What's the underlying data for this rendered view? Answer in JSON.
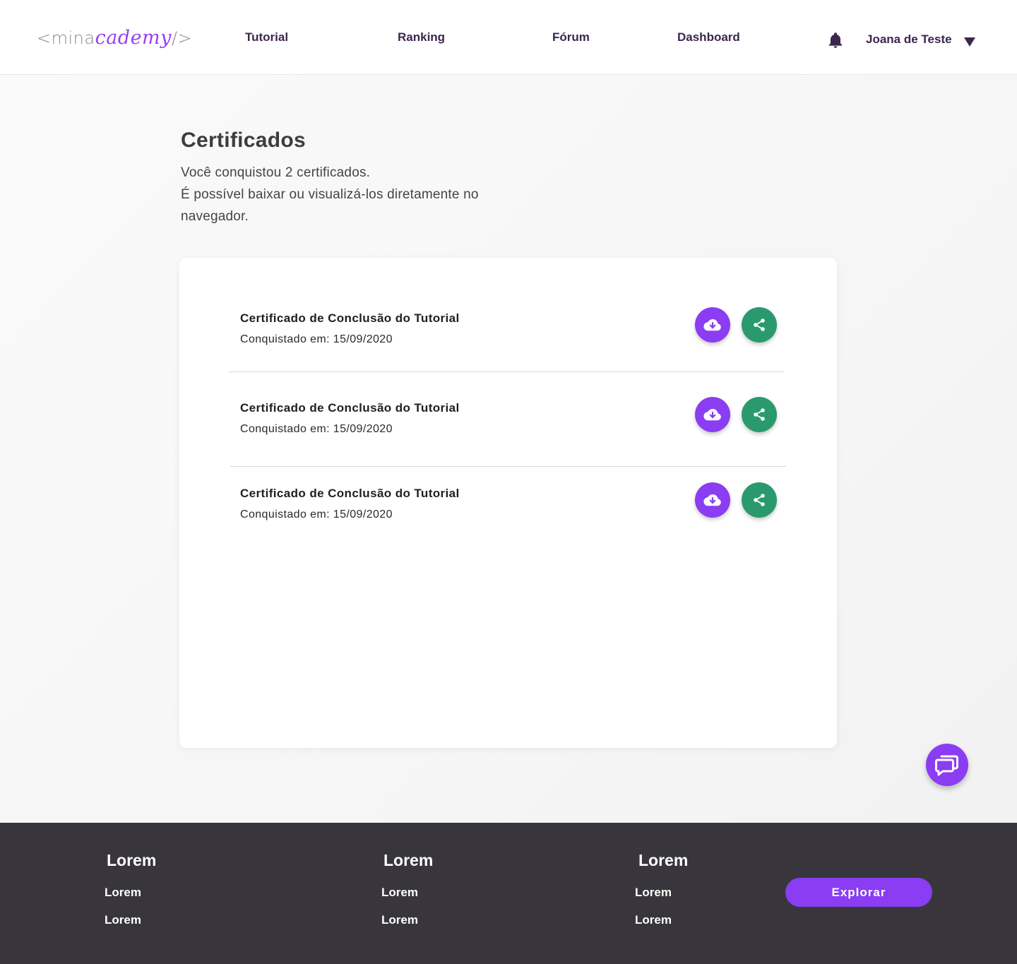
{
  "header": {
    "logo": {
      "prefix": "<mina",
      "accent": "cademy",
      "suffix": "/>"
    },
    "nav": [
      "Tutorial",
      "Ranking",
      "Fórum",
      "Dashboard"
    ],
    "user_name": "Joana de Teste"
  },
  "main": {
    "title": "Certificados",
    "intro_line1": "Você conquistou 2 certificados.",
    "intro_line2": "É possível baixar ou visualizá-los diretamente no navegador.",
    "certificates": [
      {
        "title": "Certificado de Conclusão do Tutorial",
        "date": "Conquistado em: 15/09/2020"
      },
      {
        "title": "Certificado de Conclusão do Tutorial",
        "date": "Conquistado em: 15/09/2020"
      },
      {
        "title": "Certificado de Conclusão do Tutorial",
        "date": "Conquistado em: 15/09/2020"
      }
    ]
  },
  "footer": {
    "columns": [
      {
        "heading": "Lorem",
        "links": [
          "Lorem",
          "Lorem"
        ]
      },
      {
        "heading": "Lorem",
        "links": [
          "Lorem",
          "Lorem"
        ]
      },
      {
        "heading": "Lorem",
        "links": [
          "Lorem",
          "Lorem"
        ]
      }
    ],
    "explore_label": "Explorar"
  },
  "icons": {
    "notifications": "bell-icon",
    "user_menu": "caret-down-icon",
    "download": "cloud-download-icon",
    "share": "share-icon",
    "chat": "chat-icon"
  },
  "colors": {
    "accent": "#8a3df2",
    "share": "#2a9a6e",
    "nav_text": "#3b2650",
    "footer_bg": "#38363c"
  }
}
